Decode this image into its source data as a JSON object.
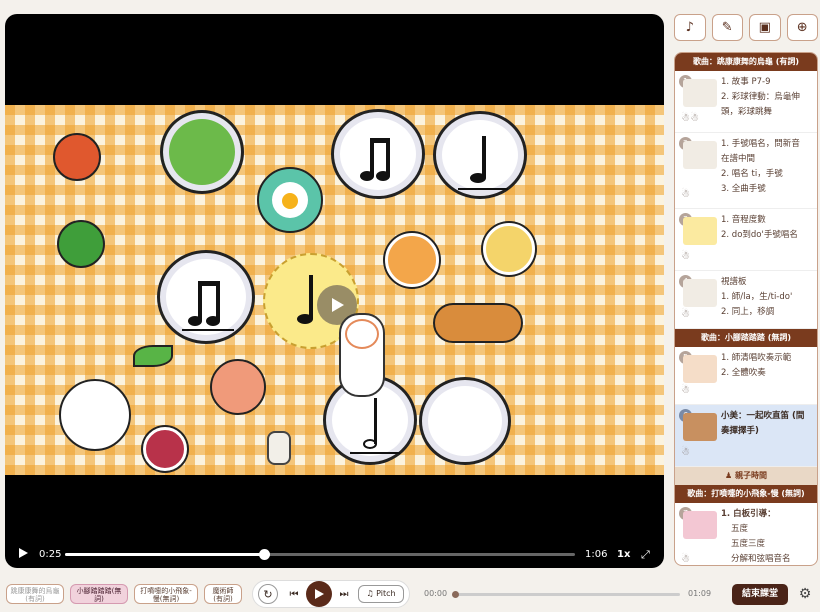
{
  "video": {
    "current_time": "0:25",
    "duration": "1:06",
    "speed": "1x",
    "progress": 0.39
  },
  "toolbar": {
    "icons": [
      "music-note-icon",
      "brush-icon",
      "gift-icon",
      "zoom-in-icon"
    ]
  },
  "playlist": {
    "sections": [
      {
        "title": "歌曲：跳康康舞的烏龜 (有詞)"
      },
      {
        "title": "歌曲：小腳踏踏踏 (無詞)"
      },
      {
        "title": "歌曲：打噴嚏的小飛象-慢 (無詞)"
      }
    ],
    "items": [
      {
        "num": "1",
        "lines": [
          "1. 故事 P7-9",
          "2. 彩球律動：烏龜伸",
          "頭，彩球跳舞"
        ]
      },
      {
        "num": "2",
        "lines": [
          "1. 手號唱名，問新音",
          "在譜中間",
          "2. 唱名 ti，手號",
          "3. 全曲手號"
        ]
      },
      {
        "num": "3",
        "lines": [
          "1. 音程度數",
          "2. do到do'手號唱名"
        ]
      },
      {
        "num": "4",
        "lines": [
          "視譜板",
          "1. 師/la，生/ti-do'",
          "2. 同上，移調"
        ]
      },
      {
        "num": "5",
        "lines": [
          "1. 師清唱吹奏示範",
          "2. 全體吹奏"
        ]
      },
      {
        "num": "6",
        "lines": [
          "小美：一起吹直笛 (間",
          "奏揮擇手)"
        ]
      },
      {
        "num": "7",
        "lines": [
          "1. 白板引導：",
          "五度",
          "五度三度",
          "分解和弦唱音名"
        ]
      }
    ],
    "parent_time": "親子時間"
  },
  "bottom": {
    "chips": [
      "跳康康舞的烏龜(有詞)",
      "小腳踏踏踏(無詞)",
      "打噴嚏的小飛象-慢(無詞)",
      "魔術師(有詞)"
    ],
    "pitch_label": "Pitch",
    "time_start": "00:00",
    "time_end": "01:09",
    "end_class_label": "結束課堂",
    "progress": 0.0
  }
}
